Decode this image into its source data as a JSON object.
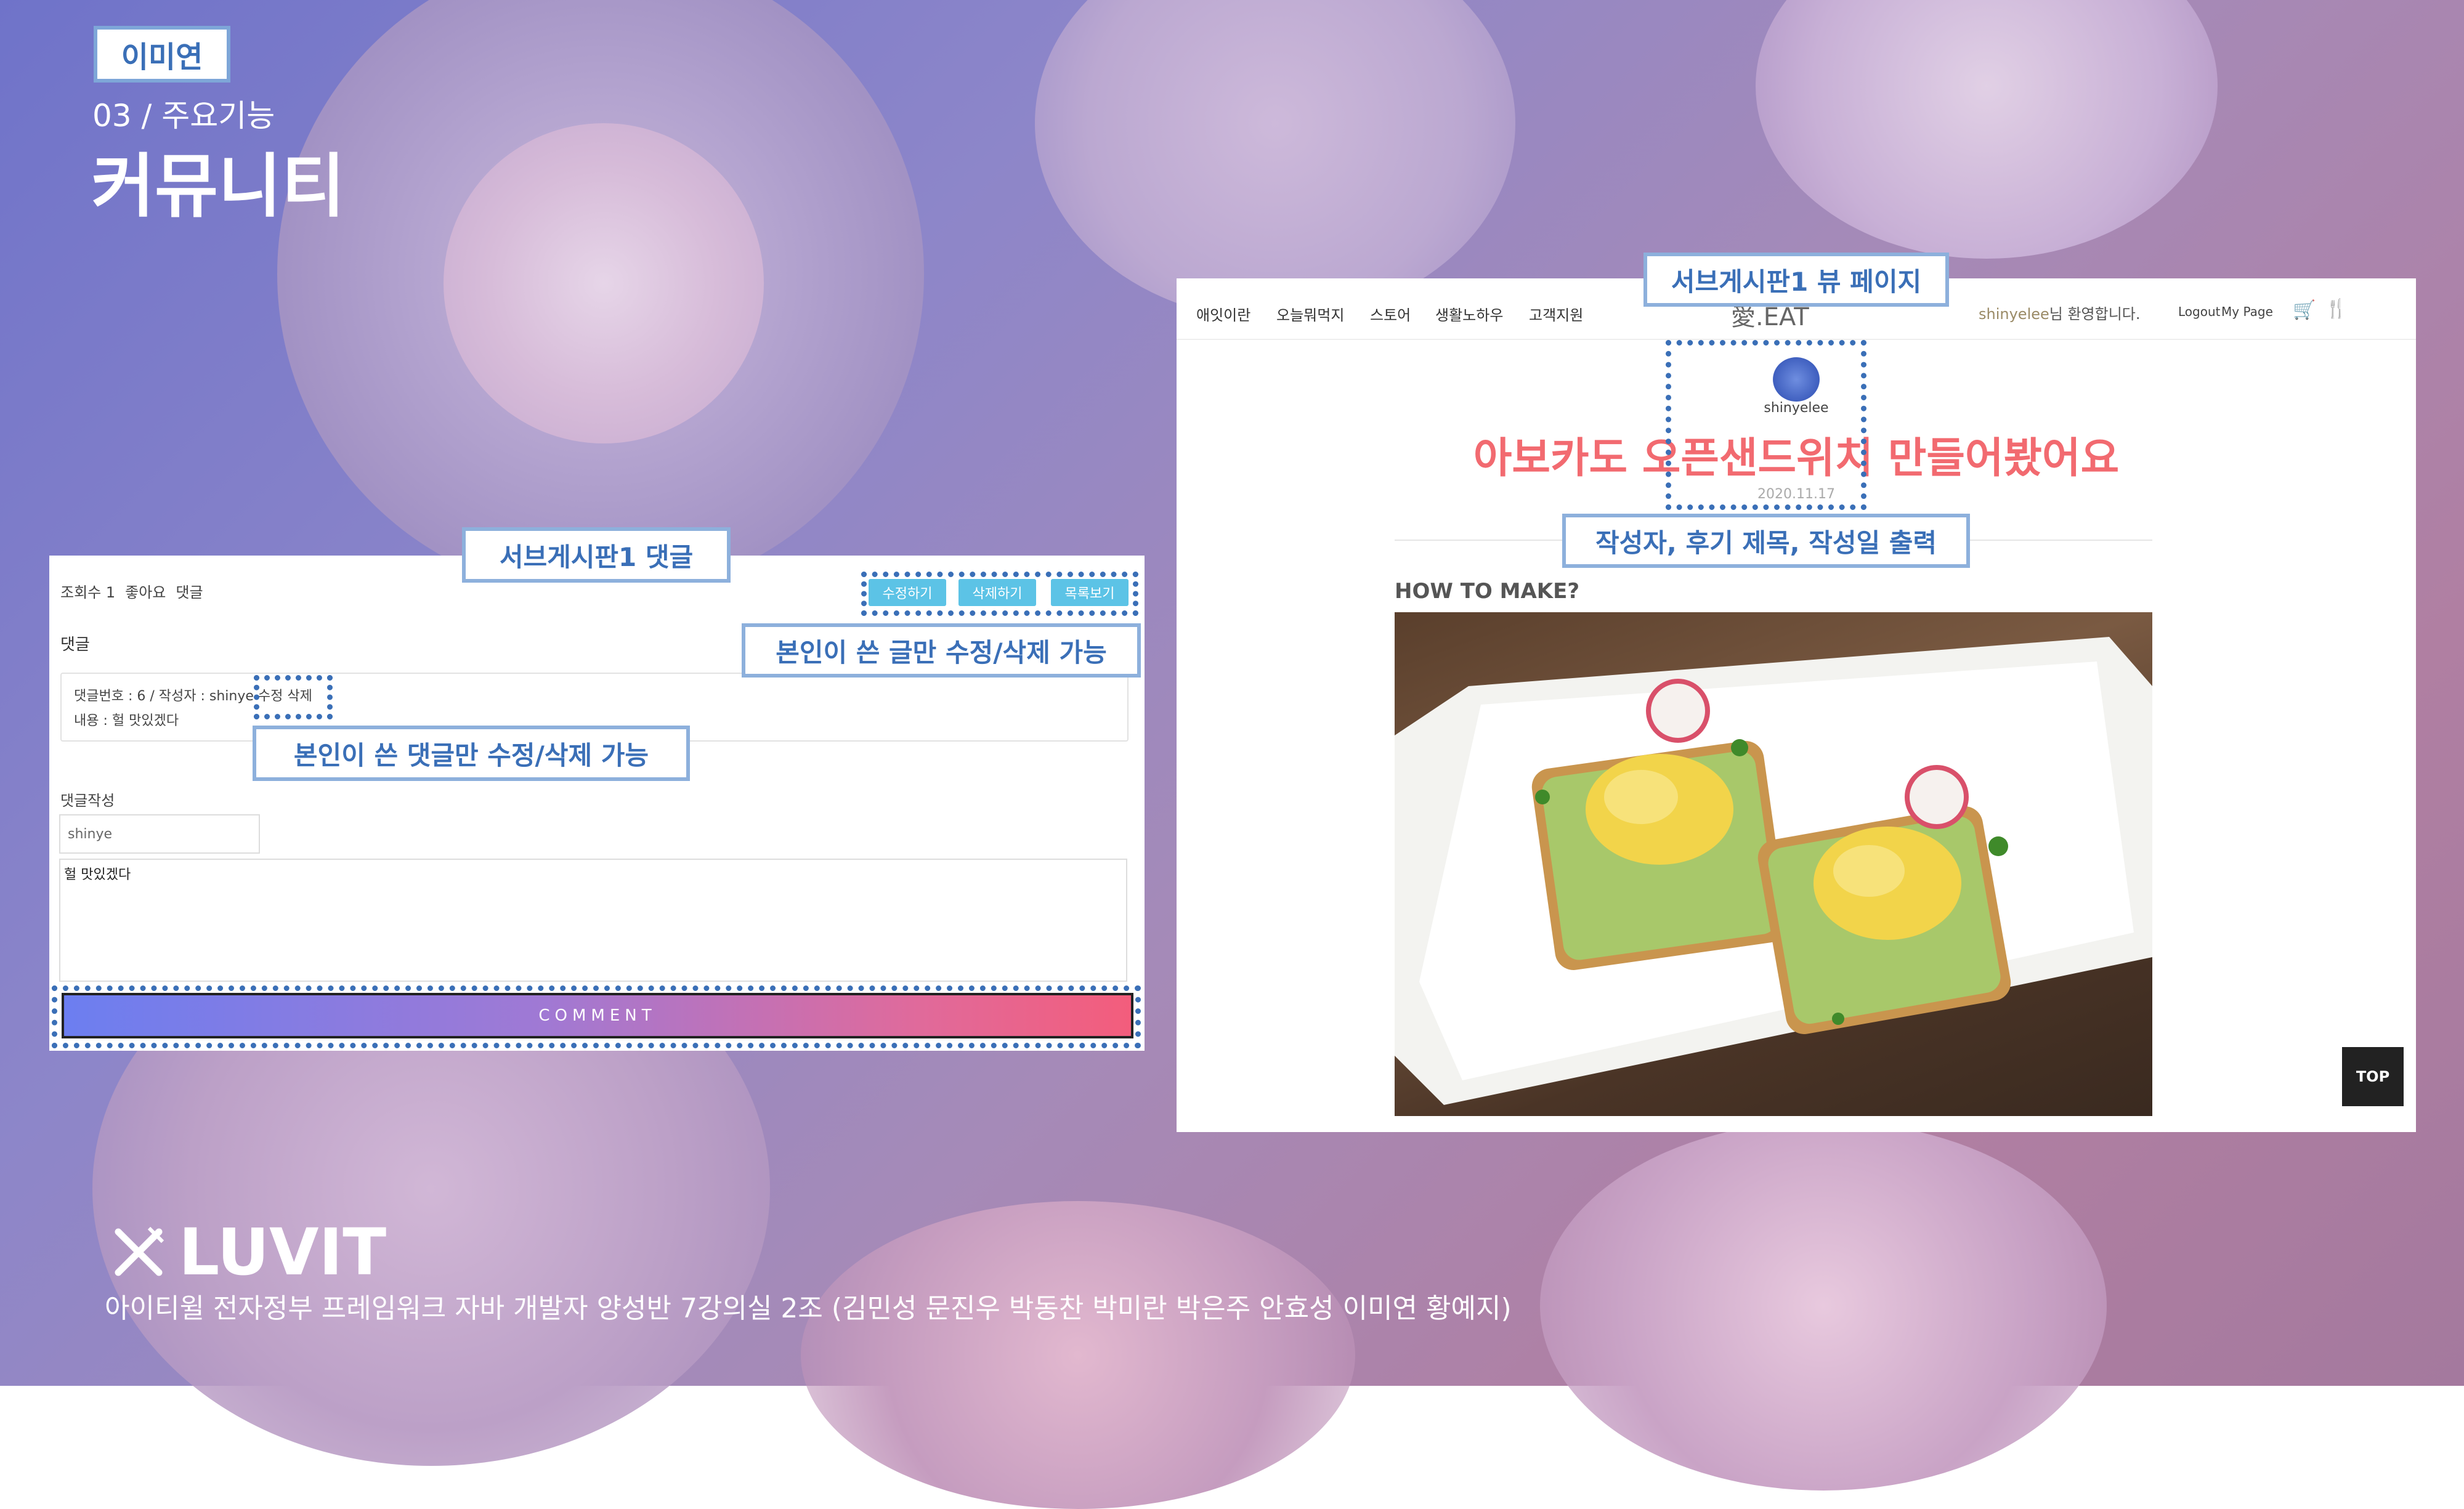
{
  "slide": {
    "author_tag": "이미연",
    "section_sub": "03 / 주요기능",
    "section_title": "커뮤니티",
    "footer_brand": "LUVIT",
    "footer_text": "아이티윌 전자정부 프레임워크 자바 개발자 양성반 7강의실 2조 (김민성 문진우 박동찬 박미란 박은주 안효성 이미연 황예지)"
  },
  "callouts": {
    "left_title": "서브게시판1 댓글",
    "left_edit_note": "본인이 쓴 글만 수정/삭제 가능",
    "left_comment_note": "본인이 쓴 댓글만 수정/삭제 가능",
    "right_title": "서브게시판1 뷰 페이지",
    "right_meta_note": "작성자, 후기 제목, 작성일 출력"
  },
  "comment_page": {
    "stats": [
      "조회수 1",
      "좋아요",
      "댓글"
    ],
    "buttons": {
      "edit": "수정하기",
      "delete": "삭제하기",
      "list": "목록보기"
    },
    "comments_header": "댓글",
    "comment_meta": "댓글번호 : 6 / 작성자 : shinye",
    "comment_actions": {
      "edit": "수정",
      "delete": "삭제"
    },
    "comment_content": "내용 : 헐 맛있겠다",
    "write_header": "댓글작성",
    "writer_value": "shinye",
    "content_value": "헐 맛있겠다",
    "submit_label": "COMMENT"
  },
  "view_page": {
    "nav": [
      "애잇이란",
      "오늘뭐먹지",
      "스토어",
      "생활노하우",
      "고객지원"
    ],
    "logo": "愛.EAT",
    "welcome_user": "shinyelee",
    "welcome_suffix": "님 환영합니다.",
    "logout": "Logout",
    "mypage": "My Page",
    "author": "shinyelee",
    "post_title": "아보카도 오픈샌드위치 만들어봤어요",
    "post_date": "2020.11.17",
    "section_heading": "HOW TO MAKE?",
    "top_button": "TOP"
  },
  "colors": {
    "accent_blue": "#3a6fb7",
    "title_pink": "#f26a70",
    "button_cyan": "#5cc3e6"
  }
}
